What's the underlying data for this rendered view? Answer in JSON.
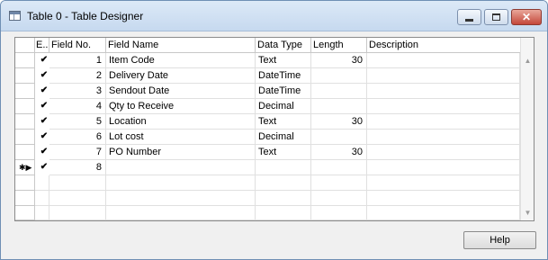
{
  "window": {
    "title": "Table 0 - Table Designer"
  },
  "grid": {
    "columns": [
      "E..",
      "Field No.",
      "Field Name",
      "Data Type",
      "Length",
      "Description"
    ],
    "rows": [
      {
        "enabled": "✔",
        "field_no": "1",
        "field_name": "Item Code",
        "data_type": "Text",
        "length": "30",
        "description": ""
      },
      {
        "enabled": "✔",
        "field_no": "2",
        "field_name": "Delivery Date",
        "data_type": "DateTime",
        "length": "",
        "description": ""
      },
      {
        "enabled": "✔",
        "field_no": "3",
        "field_name": "Sendout Date",
        "data_type": "DateTime",
        "length": "",
        "description": ""
      },
      {
        "enabled": "✔",
        "field_no": "4",
        "field_name": "Qty to Receive",
        "data_type": "Decimal",
        "length": "",
        "description": ""
      },
      {
        "enabled": "✔",
        "field_no": "5",
        "field_name": "Location",
        "data_type": "Text",
        "length": "30",
        "description": ""
      },
      {
        "enabled": "✔",
        "field_no": "6",
        "field_name": "Lot cost",
        "data_type": "Decimal",
        "length": "",
        "description": ""
      },
      {
        "enabled": "✔",
        "field_no": "7",
        "field_name": "PO Number",
        "data_type": "Text",
        "length": "30",
        "description": ""
      },
      {
        "enabled": "✔",
        "field_no": "8",
        "field_name": "",
        "data_type": "",
        "length": "",
        "description": ""
      }
    ],
    "current_row_marker": "✱▶"
  },
  "buttons": {
    "help": "Help"
  }
}
